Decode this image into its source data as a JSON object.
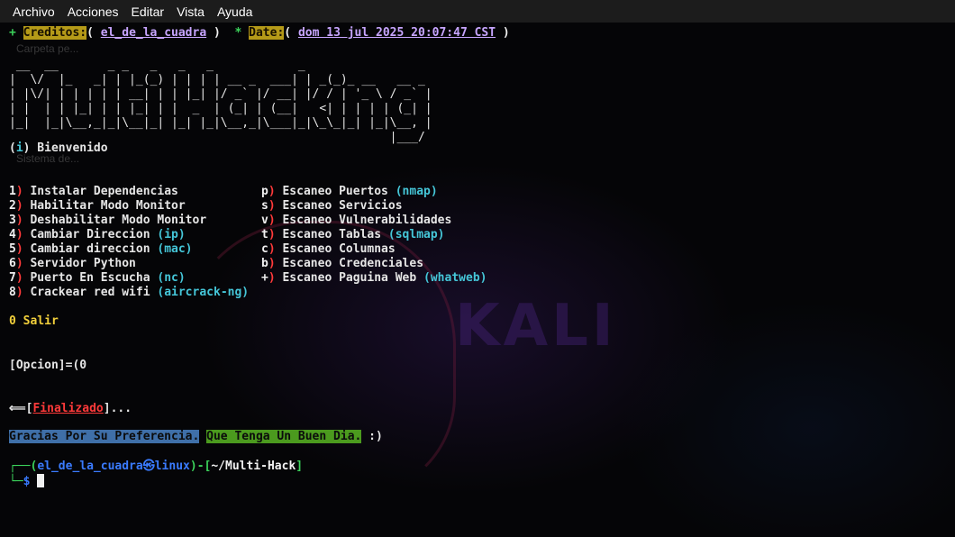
{
  "menubar": {
    "items": [
      "Archivo",
      "Acciones",
      "Editar",
      "Vista",
      "Ayuda"
    ]
  },
  "wallpaper": {
    "brand": "KALI",
    "ghost_1": "Carpeta pe...",
    "ghost_2": "Sistema de..."
  },
  "header": {
    "plus": "+",
    "creditos_label": "Creditos:",
    "creditos_open": "( ",
    "author": "el_de_la_cuadra",
    "creditos_close": " )",
    "star": "*",
    "date_label": "Date:",
    "date_open": "( ",
    "date_value": "dom 13 jul 2025 20:07:47 CST",
    "date_close": " )"
  },
  "banner": {
    "art": " __  __       _ _   _   _   _            _\n|  \\/  |_   _| | |_(_) | | | | __ _  ___| | _(_)_ __   __ _\n| |\\/| | | | | | __| | | |_| |/ _` |/ __| |/ / | '_ \\ / _` |\n| |  | | |_| | | |_| | |  _  | (_| | (__|   <| | | | | (_| |\n|_|  |_|\\__,_|_|\\__|_| |_| |_|\\__,_|\\___|_|\\_\\_|_| |_|\\__, |\n                                                      |___/"
  },
  "welcome": {
    "prefix_open": "(",
    "prefix_i": "i",
    "prefix_close": ")",
    "text": " Bienvenido"
  },
  "menu_left": [
    {
      "key": "1",
      "label": " Instalar Dependencias",
      "extra": ""
    },
    {
      "key": "2",
      "label": " Habilitar Modo Monitor",
      "extra": ""
    },
    {
      "key": "3",
      "label": " Deshabilitar Modo Monitor",
      "extra": ""
    },
    {
      "key": "4",
      "label": " Cambiar Direccion ",
      "extra": "(ip)"
    },
    {
      "key": "5",
      "label": " Cambiar direccion ",
      "extra": "(mac)"
    },
    {
      "key": "6",
      "label": " Servidor Python",
      "extra": ""
    },
    {
      "key": "7",
      "label": " Puerto En Escucha ",
      "extra": "(nc)"
    },
    {
      "key": "8",
      "label": " Crackear red wifi ",
      "extra": "(aircrack-ng)"
    }
  ],
  "menu_right": [
    {
      "key": "p",
      "label": " Escaneo Puertos ",
      "extra": "(nmap)"
    },
    {
      "key": "s",
      "label": " Escaneo Servicios",
      "extra": ""
    },
    {
      "key": "v",
      "label": " Escaneo Vulnerabilidades",
      "extra": ""
    },
    {
      "key": "t",
      "label": " Escaneo Tablas ",
      "extra": "(sqlmap)"
    },
    {
      "key": "c",
      "label": " Escaneo Columnas",
      "extra": ""
    },
    {
      "key": "b",
      "label": " Escaneo Credenciales",
      "extra": ""
    },
    {
      "key": "+",
      "label": " Escaneo Paguina Web ",
      "extra": "(whatweb)"
    }
  ],
  "menu_paren": ")",
  "exit_option": "0 Salir",
  "prompt_option": "[Opcion]=(0",
  "finalizado": {
    "arrow": "⟸",
    "open": "[",
    "word": "Finalizado",
    "close": "]",
    "dots": "..."
  },
  "farewell": {
    "part1": "Gracias Por Su Preferencia.",
    "part2": "Que Tenga Un Buen Dia.",
    "smile": " :)"
  },
  "shell_prompt": {
    "corner_top": "┌──(",
    "user": "el_de_la_cuadra",
    "at": "㉿",
    "host": "linux",
    "mid": ")-[",
    "path": "~/Multi-Hack",
    "end": "]",
    "corner_bottom": "└─",
    "dollar": "$"
  }
}
